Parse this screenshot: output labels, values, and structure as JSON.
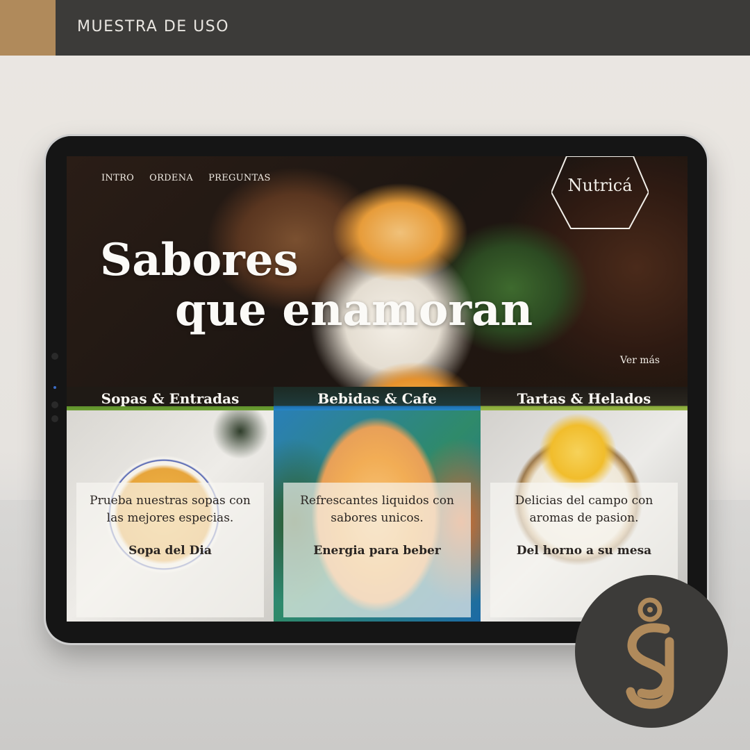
{
  "header": {
    "title": "MUESTRA DE USO"
  },
  "site": {
    "nav": [
      "INTRO",
      "ORDENA",
      "PREGUNTAS"
    ],
    "logo": "Nutricá",
    "hero": {
      "line1": "Sabores",
      "line2": "que enamoran",
      "more_link": "Ver más"
    },
    "columns": [
      {
        "title": "Sopas & Entradas",
        "desc": "Prueba nuestras sopas con las mejores especias.",
        "cta": "Sopa del Dia"
      },
      {
        "title": "Bebidas & Cafe",
        "desc": "Refrescantes liquidos con sabores unicos.",
        "cta": "Energia para beber"
      },
      {
        "title": "Tartas & Helados",
        "desc": "Delicias del campo con aromas de pasion.",
        "cta": "Del horno a su mesa"
      }
    ]
  },
  "colors": {
    "brand_gold": "#b08a5b",
    "bar_dark": "#3c3b39"
  },
  "badge": {
    "icon": "sj-monogram-icon"
  }
}
